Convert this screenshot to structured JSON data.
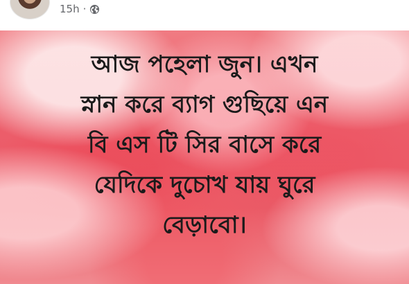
{
  "post": {
    "time": "15h",
    "separator": "·",
    "privacy_icon": "globe-icon",
    "lines": [
      "আজ পহেলা জুন। এখন",
      "স্নান করে ব্যাগ গুছিয়ে এন",
      "বি এস টি সির বাসে করে",
      "যেদিকে দুচোখ যায় ঘুরে",
      "বেড়াবো।"
    ]
  },
  "colors": {
    "background_red": "#ec5d6a",
    "text": "#1b1b1b",
    "meta_text": "#65676b"
  }
}
